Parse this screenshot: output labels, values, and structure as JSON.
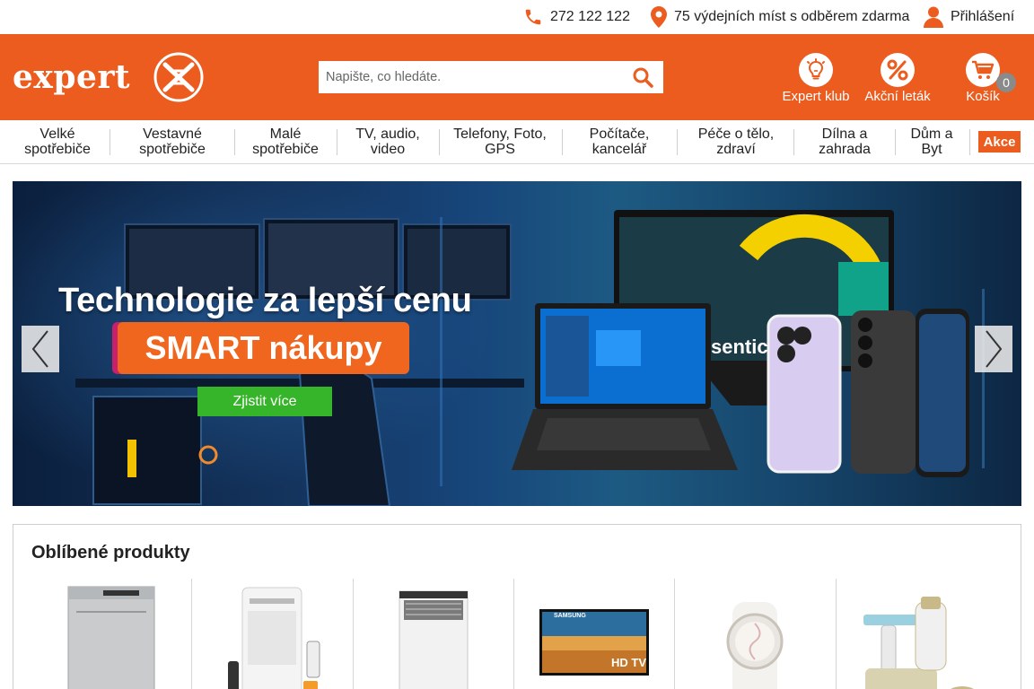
{
  "topbar": {
    "phone": "272 122 122",
    "stores": "75 výdejních míst s odběrem zdarma",
    "login": "Přihlášení",
    "icons": [
      "phone-icon",
      "location-pin-icon",
      "user-icon"
    ]
  },
  "header": {
    "logo_text": "expert",
    "search_placeholder": "Napište, co hledáte.",
    "club_label": "Expert klub",
    "leaflet_label": "Akční leták",
    "cart_label": "Košík",
    "cart_count": "0",
    "brand_color": "#eb5c1e"
  },
  "nav": {
    "categories": [
      {
        "line1": "Velké",
        "line2": "spotřebiče"
      },
      {
        "line1": "Vestavné",
        "line2": "spotřebiče"
      },
      {
        "line1": "Malé",
        "line2": "spotřebiče"
      },
      {
        "line1": "TV, audio,",
        "line2": "video"
      },
      {
        "line1": "Telefony, Foto,",
        "line2": "GPS"
      },
      {
        "line1": "Počítače,",
        "line2": "kancelář"
      },
      {
        "line1": "Péče o tělo,",
        "line2": "zdraví"
      },
      {
        "line1": "Dílna a",
        "line2": "zahrada"
      },
      {
        "line1": "Dům a",
        "line2": "Byt"
      }
    ],
    "akce": "Akce"
  },
  "hero": {
    "title": "Technologie za lepší cenu",
    "headline": "SMART nákupy",
    "cta": "Zjistit více",
    "screen_brand_fragment": "sentic",
    "cta_color": "#37b52a",
    "pill_color": "#f0661f"
  },
  "products": {
    "title": "Oblíbené produkty",
    "items": [
      {
        "icon": "dishwasher-icon"
      },
      {
        "icon": "mobile-air-conditioner-icon"
      },
      {
        "icon": "built-in-dishwasher-icon"
      },
      {
        "icon": "television-icon",
        "brand": "SAMSUNG",
        "badge": "HD TV"
      },
      {
        "icon": "smartwatch-icon"
      },
      {
        "icon": "shaver-set-icon"
      }
    ]
  }
}
